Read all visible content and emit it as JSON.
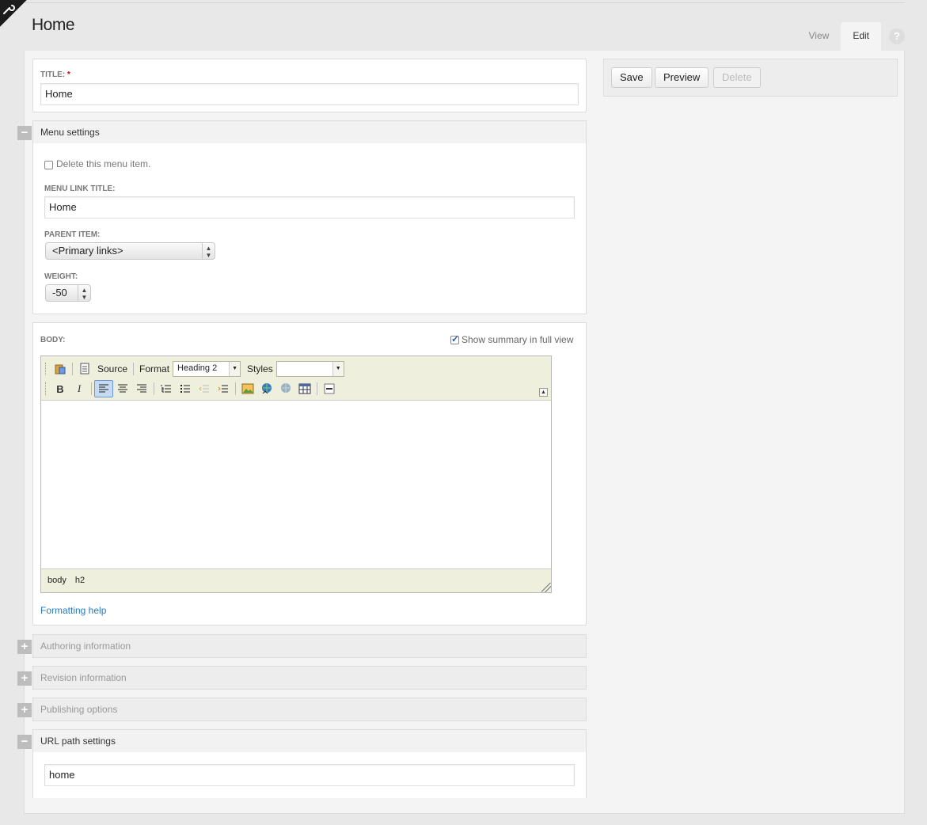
{
  "page": {
    "title": "Home"
  },
  "tabs": [
    {
      "label": "View"
    },
    {
      "label": "Edit"
    }
  ],
  "help": {
    "glyph": "?"
  },
  "title_field": {
    "label": "TITLE:",
    "required_mark": "*",
    "value": "Home"
  },
  "menu_settings": {
    "legend": "Menu settings",
    "toggle": "−",
    "delete_label": "Delete this menu item.",
    "link_title_label": "MENU LINK TITLE:",
    "link_title_value": "Home",
    "parent_label": "PARENT ITEM:",
    "parent_value": "<Primary links>",
    "weight_label": "WEIGHT:",
    "weight_value": "-50"
  },
  "body_field": {
    "label": "BODY:",
    "summary_label": "Show summary in full view",
    "toolbar": {
      "source_label": "Source",
      "format_label": "Format",
      "format_value": "Heading 2",
      "styles_label": "Styles",
      "styles_value": ""
    },
    "path": [
      "body",
      "h2"
    ],
    "formatting_help": "Formatting help"
  },
  "collapsed_sections": [
    {
      "legend": "Authoring information",
      "toggle": "+"
    },
    {
      "legend": "Revision information",
      "toggle": "+"
    },
    {
      "legend": "Publishing options",
      "toggle": "+"
    }
  ],
  "url_path": {
    "legend": "URL path settings",
    "toggle": "−",
    "value": "home"
  },
  "actions": {
    "save": "Save",
    "preview": "Preview",
    "delete": "Delete"
  },
  "colors": {
    "link": "#2a7ab8",
    "required": "#cc0000",
    "toolbar_bg": "#efefde"
  }
}
